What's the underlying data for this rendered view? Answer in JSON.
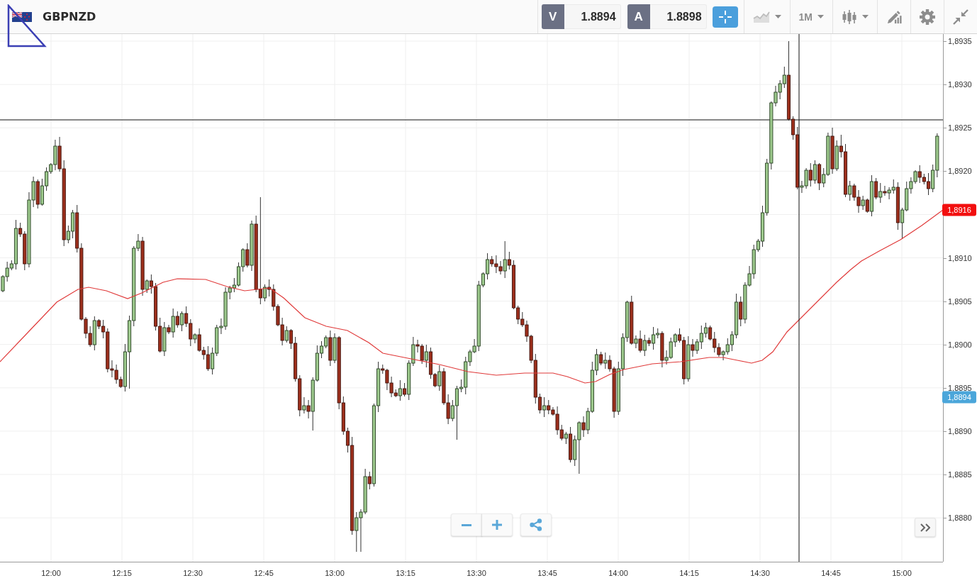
{
  "header": {
    "symbol": "GBPNZD",
    "quotes": [
      {
        "side": "V",
        "price": "1.8894"
      },
      {
        "side": "A",
        "price": "1.8898"
      }
    ],
    "tools": [
      {
        "kind": "crosshair",
        "on": true,
        "menu": false
      },
      {
        "kind": "chart-type",
        "on": false,
        "menu": true
      },
      {
        "kind": "interval",
        "label": "1M",
        "on": false,
        "menu": true
      },
      {
        "kind": "candles",
        "on": false,
        "menu": true
      },
      {
        "kind": "draw",
        "on": false,
        "menu": false
      },
      {
        "kind": "settings",
        "on": false,
        "menu": false
      },
      {
        "kind": "collapse",
        "on": false,
        "menu": false
      }
    ]
  },
  "chart": {
    "y_ticks": [
      "1,8935",
      "1,8930",
      "1,8925",
      "1,8920",
      "1,8910",
      "1,8905",
      "1,8900",
      "1,8895",
      "1,8890",
      "1,8885",
      "1,8880"
    ],
    "x_ticks": [
      "12:00",
      "12:15",
      "12:30",
      "12:45",
      "13:00",
      "13:15",
      "13:30",
      "13:45",
      "14:00",
      "14:15",
      "14:30",
      "14:45",
      "15:00"
    ],
    "price_markers": [
      {
        "label": "1,8916",
        "color": "#f20f0f"
      },
      {
        "label": "1,8894",
        "color": "#4ba6da"
      }
    ]
  }
}
